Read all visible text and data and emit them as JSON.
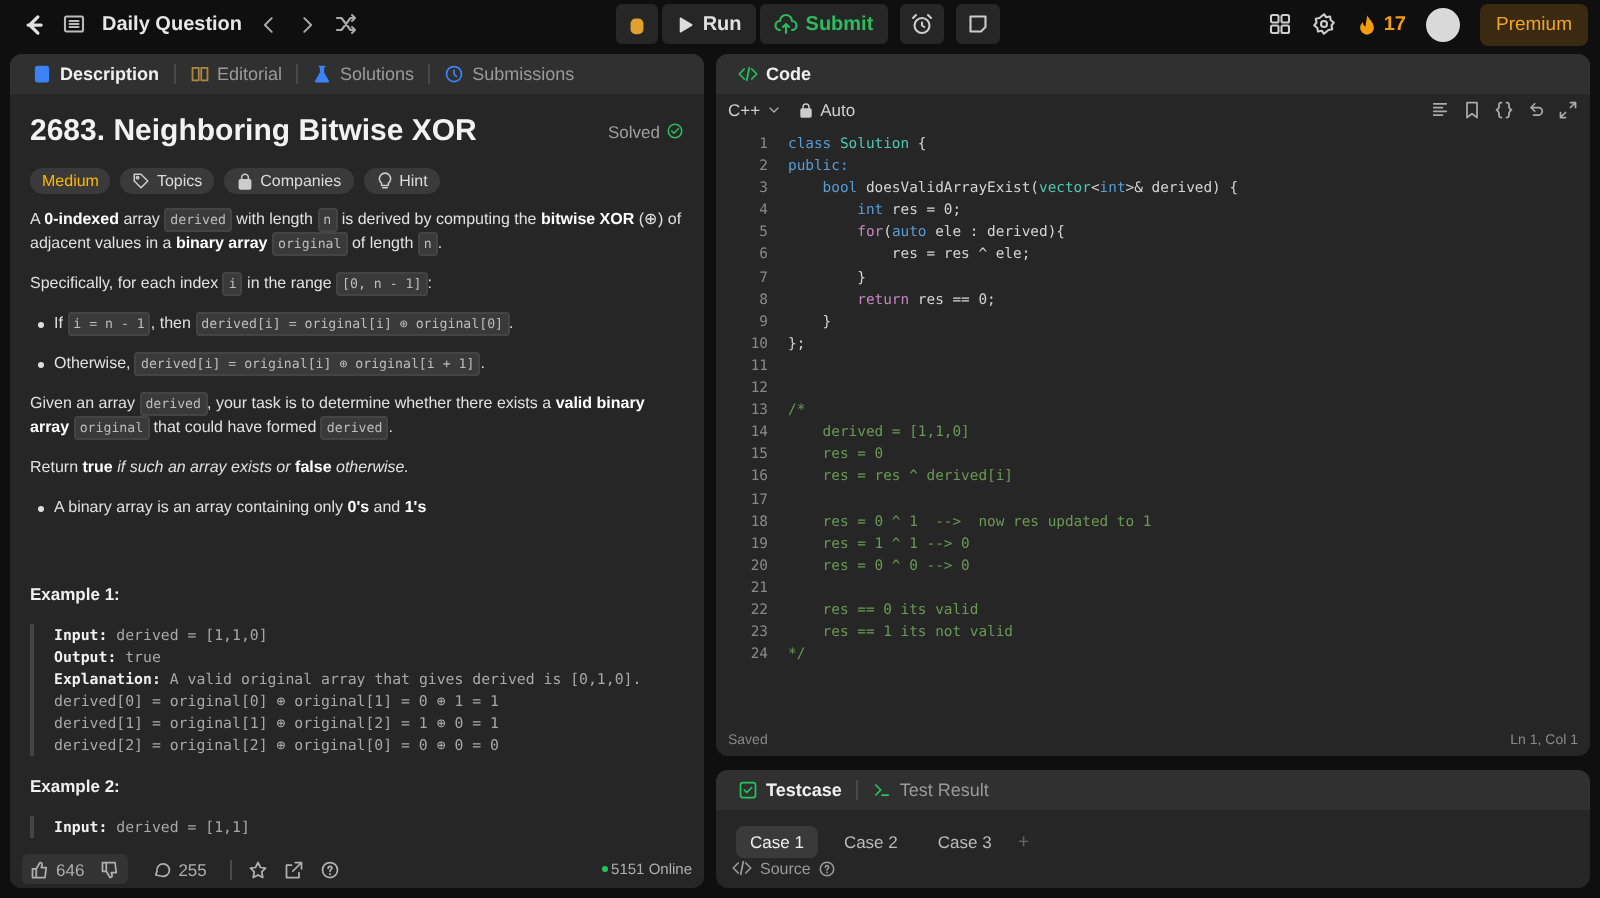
{
  "top_bar": {
    "title": "Daily Question",
    "run": "Run",
    "submit": "Submit",
    "streak": "17",
    "premium": "Premium"
  },
  "description_panel": {
    "tabs": [
      {
        "label": "Description",
        "kind": "description",
        "selected": true
      },
      {
        "label": "Editorial",
        "kind": "editorial",
        "selected": false
      },
      {
        "label": "Solutions",
        "kind": "solutions",
        "selected": false
      },
      {
        "label": "Submissions",
        "kind": "submissions",
        "selected": false
      }
    ],
    "title": "2683. Neighboring Bitwise XOR",
    "status": "Solved",
    "tags": [
      {
        "label": "Medium",
        "kind": "difficulty"
      },
      {
        "label": "Topics",
        "kind": "topics"
      },
      {
        "label": "Companies",
        "kind": "companies"
      },
      {
        "label": "Hint",
        "kind": "hint"
      }
    ],
    "blocks": [
      {
        "kind": "paragraph",
        "segments": [
          {
            "kind": "text",
            "text": "A **0-indexed** array "
          },
          {
            "kind": "code",
            "text": "derived"
          },
          {
            "kind": "text",
            "text": " with length "
          },
          {
            "kind": "code",
            "text": "n"
          },
          {
            "kind": "text",
            "text": " is derived by computing the **bitwise XOR** (⊕) of adjacent values in a **binary array** "
          },
          {
            "kind": "code",
            "text": "original"
          },
          {
            "kind": "text",
            "text": " of length "
          },
          {
            "kind": "code",
            "text": "n"
          },
          {
            "kind": "text",
            "text": "."
          }
        ]
      },
      {
        "kind": "paragraph",
        "segments": [
          {
            "kind": "text",
            "text": "Specifically, for each index "
          },
          {
            "kind": "code",
            "text": "i"
          },
          {
            "kind": "text",
            "text": " in the range "
          },
          {
            "kind": "code",
            "text": "[0, n - 1]"
          },
          {
            "kind": "text",
            "text": ":"
          }
        ]
      },
      {
        "kind": "bullet",
        "segments": [
          {
            "kind": "text",
            "text": "If "
          },
          {
            "kind": "code",
            "text": "i = n - 1"
          },
          {
            "kind": "text",
            "text": ", then "
          },
          {
            "kind": "code",
            "text": "derived[i] = original[i] ⊕ original[0]"
          },
          {
            "kind": "text",
            "text": "."
          }
        ]
      },
      {
        "kind": "bullet",
        "segments": [
          {
            "kind": "text",
            "text": "Otherwise, "
          },
          {
            "kind": "code",
            "text": "derived[i] = original[i] ⊕ original[i + 1]"
          },
          {
            "kind": "text",
            "text": "."
          }
        ]
      },
      {
        "kind": "paragraph",
        "segments": [
          {
            "kind": "text",
            "text": "Given an array "
          },
          {
            "kind": "code",
            "text": "derived"
          },
          {
            "kind": "text",
            "text": ", your task is to determine whether there exists a **valid binary array** "
          },
          {
            "kind": "code",
            "text": "original"
          },
          {
            "kind": "text",
            "text": " that could have formed "
          },
          {
            "kind": "code",
            "text": "derived"
          },
          {
            "kind": "text",
            "text": "."
          }
        ]
      },
      {
        "kind": "paragraph",
        "segments": [
          {
            "kind": "text",
            "text": "Return **true** *if such an array exists or* **false** *otherwise.*"
          }
        ]
      },
      {
        "kind": "bullet",
        "segments": [
          {
            "kind": "text",
            "text": "A binary array is an array containing only **0's** and **1's**"
          }
        ]
      }
    ],
    "examples": [
      {
        "title": "Example 1:",
        "lines": [
          {
            "label": "Input:",
            "text": "derived = [1,1,0]"
          },
          {
            "label": "Output:",
            "text": "true"
          },
          {
            "label": "Explanation:",
            "text": "A valid original array that gives derived is [0,1,0]."
          },
          {
            "text": "derived[0] = original[0] ⊕ original[1] = 0 ⊕ 1 = 1"
          },
          {
            "text": "derived[1] = original[1] ⊕ original[2] = 1 ⊕ 0 = 1"
          },
          {
            "text": "derived[2] = original[2] ⊕ original[0] = 0 ⊕ 0 = 0"
          }
        ]
      },
      {
        "title": "Example 2:",
        "lines": [
          {
            "label": "Input:",
            "text": "derived = [1,1]"
          }
        ]
      }
    ],
    "footer": {
      "likes": "646",
      "comments": "255",
      "online": "5151 Online"
    }
  },
  "code_panel": {
    "title": "Code",
    "language": "C++",
    "mode": "Auto",
    "lines": [
      {
        "number": "1",
        "tokens": [
          {
            "kind": "keyword",
            "text": "class "
          },
          {
            "kind": "type",
            "text": "Solution"
          },
          {
            "kind": "plain",
            "text": " {"
          }
        ]
      },
      {
        "number": "2",
        "tokens": [
          {
            "kind": "keyword",
            "text": "public:"
          }
        ]
      },
      {
        "number": "3",
        "tokens": [
          {
            "kind": "keyword",
            "text": "    bool"
          },
          {
            "kind": "plain",
            "text": " doesValidArrayExist("
          },
          {
            "kind": "type",
            "text": "vector"
          },
          {
            "kind": "plain",
            "text": "<"
          },
          {
            "kind": "keyword",
            "text": "int"
          },
          {
            "kind": "plain",
            "text": ">& derived) {"
          }
        ]
      },
      {
        "number": "4",
        "tokens": [
          {
            "kind": "keyword",
            "text": "        int"
          },
          {
            "kind": "plain",
            "text": " res = 0;"
          }
        ]
      },
      {
        "number": "5",
        "tokens": [
          {
            "kind": "control",
            "text": "        for"
          },
          {
            "kind": "plain",
            "text": "("
          },
          {
            "kind": "keyword",
            "text": "auto"
          },
          {
            "kind": "plain",
            "text": " ele : derived){"
          }
        ]
      },
      {
        "number": "6",
        "tokens": [
          {
            "kind": "plain",
            "text": "            res = res ^ ele;"
          }
        ]
      },
      {
        "number": "7",
        "tokens": [
          {
            "kind": "plain",
            "text": "        }"
          }
        ]
      },
      {
        "number": "8",
        "tokens": [
          {
            "kind": "control",
            "text": "        return"
          },
          {
            "kind": "plain",
            "text": " res == 0;"
          }
        ]
      },
      {
        "number": "9",
        "tokens": [
          {
            "kind": "plain",
            "text": "    }"
          }
        ]
      },
      {
        "number": "10",
        "tokens": [
          {
            "kind": "plain",
            "text": "};"
          }
        ]
      },
      {
        "number": "11"
      },
      {
        "number": "12"
      },
      {
        "number": "13",
        "tokens": [
          {
            "kind": "comment",
            "text": "/*"
          }
        ]
      },
      {
        "number": "14",
        "tokens": [
          {
            "kind": "comment",
            "text": "    derived = [1,1,0]"
          }
        ]
      },
      {
        "number": "15",
        "tokens": [
          {
            "kind": "comment",
            "text": "    res = 0"
          }
        ]
      },
      {
        "number": "16",
        "tokens": [
          {
            "kind": "comment",
            "text": "    res = res ^ derived[i]"
          }
        ]
      },
      {
        "number": "17"
      },
      {
        "number": "18",
        "tokens": [
          {
            "kind": "comment",
            "text": "    res = 0 ^ 1  -->  now res updated to 1"
          }
        ]
      },
      {
        "number": "19",
        "tokens": [
          {
            "kind": "comment",
            "text": "    res = 1 ^ 1 --> 0"
          }
        ]
      },
      {
        "number": "20",
        "tokens": [
          {
            "kind": "comment",
            "text": "    res = 0 ^ 0 --> 0"
          }
        ]
      },
      {
        "number": "21"
      },
      {
        "number": "22",
        "tokens": [
          {
            "kind": "comment",
            "text": "    res == 0 its valid"
          }
        ]
      },
      {
        "number": "23",
        "tokens": [
          {
            "kind": "comment",
            "text": "    res == 1 its not valid"
          }
        ]
      },
      {
        "number": "24",
        "tokens": [
          {
            "kind": "comment",
            "text": "*/"
          }
        ]
      }
    ],
    "status": "Saved",
    "cursor": "Ln 1, Col 1"
  },
  "test_panel": {
    "tabs": [
      {
        "label": "Testcase",
        "kind": "testcase",
        "selected": true
      },
      {
        "label": "Test Result",
        "kind": "result",
        "selected": false
      }
    ],
    "cases": [
      {
        "label": "Case 1",
        "selected": true
      },
      {
        "label": "Case 2",
        "selected": false
      },
      {
        "label": "Case 3",
        "selected": false
      }
    ],
    "add": "+",
    "source": "Source"
  }
}
